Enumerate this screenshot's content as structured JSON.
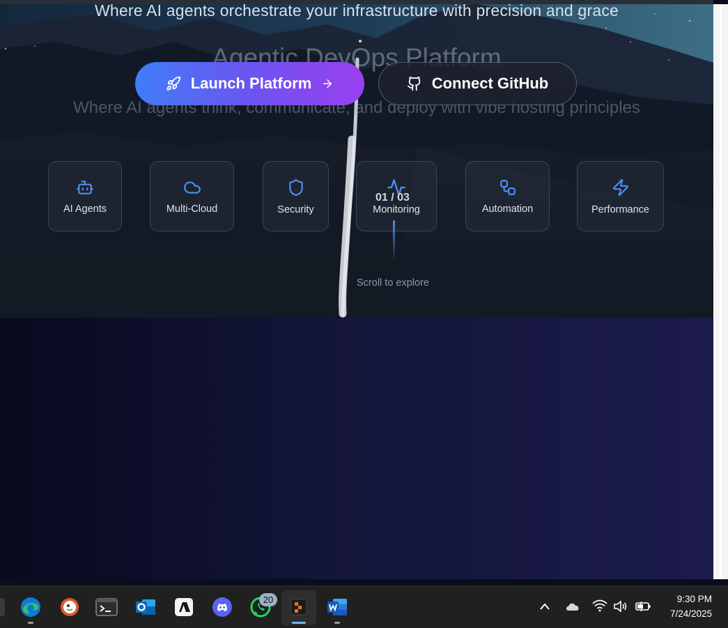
{
  "hero": {
    "tagline": "Where AI agents orchestrate your infrastructure with precision and grace",
    "ghost_title": "Agentic DevOps Platform",
    "ghost_subtitle": "Where AI agents think, communicate, and deploy with vibe hosting principles"
  },
  "buttons": {
    "launch_label": "Launch Platform",
    "github_label": "Connect GitHub"
  },
  "features": [
    {
      "label": "AI Agents",
      "icon": "bot-icon"
    },
    {
      "label": "Multi-Cloud",
      "icon": "cloud-icon"
    },
    {
      "label": "Security",
      "icon": "shield-icon"
    },
    {
      "label": "Monitoring",
      "icon": "activity-icon"
    },
    {
      "label": "Automation",
      "icon": "workflow-icon"
    },
    {
      "label": "Performance",
      "icon": "zap-icon"
    }
  ],
  "slider": {
    "counter": "01 / 03",
    "scroll_hint": "Scroll to explore"
  },
  "taskbar": {
    "apps": [
      "edge-icon",
      "duckduckgo-icon",
      "terminal-icon",
      "outlook-icon",
      "anthropic-icon",
      "discord-icon",
      "whatsapp-icon",
      "app-icon",
      "word-icon"
    ],
    "whatsapp_badge": "20",
    "time": "9:30 PM",
    "date": "7/24/2025"
  },
  "colors": {
    "accent_start": "#3f7df7",
    "accent_end": "#9b3ff0",
    "icon_blue": "#4f8ff0"
  }
}
